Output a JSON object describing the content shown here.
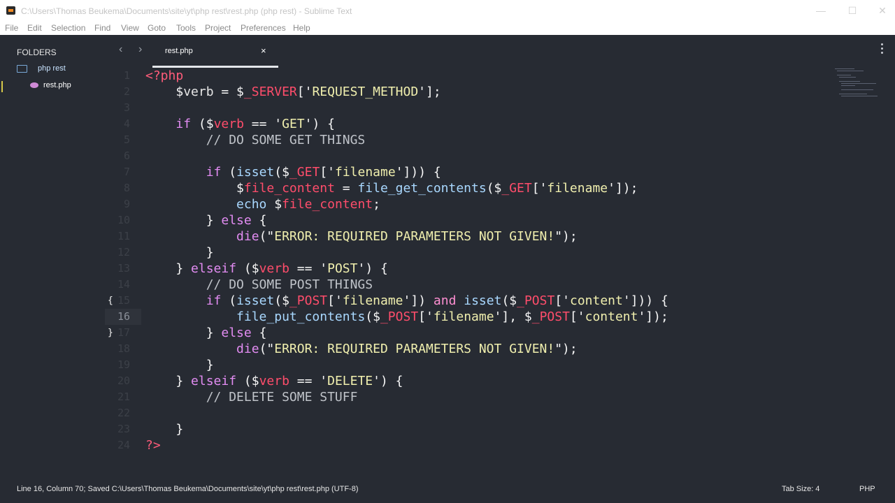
{
  "window": {
    "title": "C:\\Users\\Thomas Beukema\\Documents\\site\\yt\\php rest\\rest.php (php rest) - Sublime Text",
    "controls": [
      "—",
      "☐",
      "✕"
    ]
  },
  "menu": [
    "File",
    "Edit",
    "Selection",
    "Find",
    "View",
    "Goto",
    "Tools",
    "Project",
    "Preferences",
    "Help"
  ],
  "sidebar": {
    "title": "FOLDERS",
    "folder": "php rest",
    "file": "rest.php"
  },
  "tabs": [
    {
      "label": "rest.php",
      "close": "×"
    }
  ],
  "nav": {
    "back": "‹",
    "forward": "›"
  },
  "editor": {
    "active_line": 16,
    "lines": [
      {
        "n": "1",
        "tokens": [
          [
            "tag",
            "<?php"
          ]
        ]
      },
      {
        "n": "2",
        "tokens": [
          [
            "sym",
            "    $"
          ],
          [
            "name",
            "verb"
          ],
          [
            "sym",
            " = $"
          ],
          [
            "global",
            "_SERVER"
          ],
          [
            "sym",
            "['"
          ],
          [
            "str",
            "REQUEST_METHOD"
          ],
          [
            "sym",
            "'];"
          ]
        ]
      },
      {
        "n": "3",
        "tokens": []
      },
      {
        "n": "4",
        "tokens": [
          [
            "sym",
            "    "
          ],
          [
            "kw",
            "if"
          ],
          [
            "sym",
            " ($"
          ],
          [
            "global",
            "verb"
          ],
          [
            "sym",
            " == '"
          ],
          [
            "str",
            "GET"
          ],
          [
            "sym",
            "') {"
          ]
        ]
      },
      {
        "n": "5",
        "tokens": [
          [
            "com",
            "        // DO SOME GET THINGS"
          ]
        ]
      },
      {
        "n": "6",
        "tokens": []
      },
      {
        "n": "7",
        "tokens": [
          [
            "sym",
            "        "
          ],
          [
            "kw",
            "if"
          ],
          [
            "sym",
            " ("
          ],
          [
            "fn",
            "isset"
          ],
          [
            "sym",
            "($"
          ],
          [
            "global",
            "_GET"
          ],
          [
            "sym",
            "['"
          ],
          [
            "str",
            "filename"
          ],
          [
            "sym",
            "'])) {"
          ]
        ]
      },
      {
        "n": "8",
        "tokens": [
          [
            "sym",
            "            $"
          ],
          [
            "global",
            "file_content"
          ],
          [
            "sym",
            " = "
          ],
          [
            "fn",
            "file_get_contents"
          ],
          [
            "sym",
            "($"
          ],
          [
            "global",
            "_GET"
          ],
          [
            "sym",
            "['"
          ],
          [
            "str",
            "filename"
          ],
          [
            "sym",
            "']);"
          ]
        ]
      },
      {
        "n": "9",
        "tokens": [
          [
            "sym",
            "            "
          ],
          [
            "fn",
            "echo"
          ],
          [
            "sym",
            " $"
          ],
          [
            "global",
            "file_content"
          ],
          [
            "sym",
            ";"
          ]
        ]
      },
      {
        "n": "10",
        "tokens": [
          [
            "sym",
            "        } "
          ],
          [
            "kw",
            "else"
          ],
          [
            "sym",
            " {"
          ]
        ]
      },
      {
        "n": "11",
        "tokens": [
          [
            "sym",
            "            "
          ],
          [
            "kw",
            "die"
          ],
          [
            "sym",
            "(\""
          ],
          [
            "str",
            "ERROR: REQUIRED PARAMETERS NOT GIVEN!"
          ],
          [
            "sym",
            "\");"
          ]
        ]
      },
      {
        "n": "12",
        "tokens": [
          [
            "sym",
            "        }"
          ]
        ]
      },
      {
        "n": "13",
        "tokens": [
          [
            "sym",
            "    } "
          ],
          [
            "kw",
            "elseif"
          ],
          [
            "sym",
            " ($"
          ],
          [
            "global",
            "verb"
          ],
          [
            "sym",
            " == '"
          ],
          [
            "str",
            "POST"
          ],
          [
            "sym",
            "') {"
          ]
        ]
      },
      {
        "n": "14",
        "tokens": [
          [
            "com",
            "        // DO SOME POST THINGS"
          ]
        ]
      },
      {
        "n": "15",
        "fold": "{",
        "tokens": [
          [
            "sym",
            "        "
          ],
          [
            "kw",
            "if"
          ],
          [
            "sym",
            " ("
          ],
          [
            "fn",
            "isset"
          ],
          [
            "sym",
            "($"
          ],
          [
            "global",
            "_POST"
          ],
          [
            "sym",
            "['"
          ],
          [
            "str",
            "filename"
          ],
          [
            "sym",
            "']) "
          ],
          [
            "op",
            "and"
          ],
          [
            "sym",
            " "
          ],
          [
            "fn",
            "isset"
          ],
          [
            "sym",
            "($"
          ],
          [
            "global",
            "_POST"
          ],
          [
            "sym",
            "['"
          ],
          [
            "str",
            "content"
          ],
          [
            "sym",
            "'])) {"
          ]
        ]
      },
      {
        "n": "16",
        "tokens": [
          [
            "sym",
            "            "
          ],
          [
            "fn",
            "file_put_contents"
          ],
          [
            "sym",
            "($"
          ],
          [
            "global",
            "_POST"
          ],
          [
            "sym",
            "['"
          ],
          [
            "str",
            "filename"
          ],
          [
            "sym",
            "'], $"
          ],
          [
            "global",
            "_POST"
          ],
          [
            "sym",
            "['"
          ],
          [
            "str",
            "content"
          ],
          [
            "sym",
            "']);"
          ]
        ]
      },
      {
        "n": "17",
        "fold": "}",
        "tokens": [
          [
            "sym",
            "        } "
          ],
          [
            "kw",
            "else"
          ],
          [
            "sym",
            " {"
          ]
        ]
      },
      {
        "n": "18",
        "tokens": [
          [
            "sym",
            "            "
          ],
          [
            "kw",
            "die"
          ],
          [
            "sym",
            "(\""
          ],
          [
            "str",
            "ERROR: REQUIRED PARAMETERS NOT GIVEN!"
          ],
          [
            "sym",
            "\");"
          ]
        ]
      },
      {
        "n": "19",
        "tokens": [
          [
            "sym",
            "        }"
          ]
        ]
      },
      {
        "n": "20",
        "tokens": [
          [
            "sym",
            "    } "
          ],
          [
            "kw",
            "elseif"
          ],
          [
            "sym",
            " ($"
          ],
          [
            "global",
            "verb"
          ],
          [
            "sym",
            " == '"
          ],
          [
            "str",
            "DELETE"
          ],
          [
            "sym",
            "') {"
          ]
        ]
      },
      {
        "n": "21",
        "tokens": [
          [
            "com",
            "        // DELETE SOME STUFF"
          ]
        ]
      },
      {
        "n": "22",
        "tokens": []
      },
      {
        "n": "23",
        "tokens": [
          [
            "sym",
            "    }"
          ]
        ]
      },
      {
        "n": "24",
        "tokens": [
          [
            "tag",
            "?>"
          ]
        ]
      }
    ]
  },
  "status": {
    "text": "Line 16, Column 70; Saved C:\\Users\\Thomas Beukema\\Documents\\site\\yt\\php rest\\rest.php (UTF-8)",
    "tab_size": "Tab Size: 4",
    "syntax": "PHP"
  },
  "colors": {
    "background": "#272b33",
    "tag": "#ff5c7a",
    "keyword": "#e28cf2",
    "string": "#f0efae",
    "function": "#a9d8ff",
    "comment": "#bfc3c9"
  },
  "icons": [
    "app-icon",
    "folder-icon",
    "php-file-icon",
    "tab-close-icon",
    "nav-back-icon",
    "nav-forward-icon",
    "tab-menu-icon"
  ]
}
